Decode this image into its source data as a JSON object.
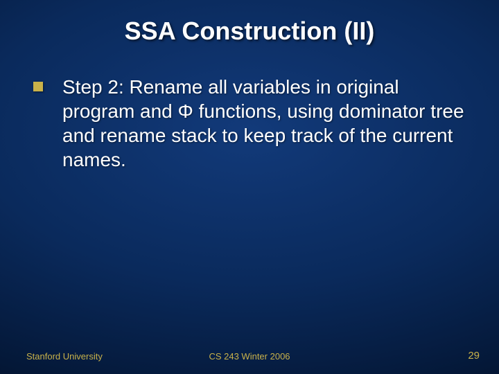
{
  "title": "SSA Construction (II)",
  "bullet_text": "Step 2: Rename all variables in original program and Φ functions, using dominator tree and rename stack to keep track of the current names.",
  "footer": {
    "left": "Stanford University",
    "center": "CS 243 Winter 2006",
    "right": "29"
  }
}
